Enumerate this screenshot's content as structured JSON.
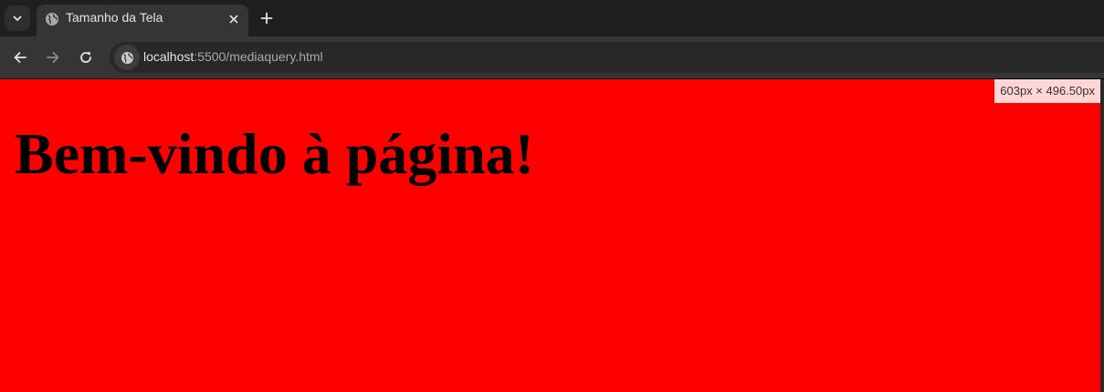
{
  "browser": {
    "tab": {
      "title": "Tamanho da Tela",
      "icon": "globe-icon"
    },
    "address_bar": {
      "host": "localhost",
      "rest": ":5500/mediaquery.html"
    },
    "icons": {
      "tab_list": "chevron-down-icon",
      "close": "close-icon",
      "new_tab": "plus-icon",
      "back": "arrow-left-icon",
      "forward": "arrow-right-icon",
      "reload": "reload-icon",
      "site_info": "globe-icon"
    }
  },
  "page": {
    "heading": "Bem-vindo à página!",
    "size_indicator": "603px × 496.50px",
    "background_color": "#ff0000"
  }
}
